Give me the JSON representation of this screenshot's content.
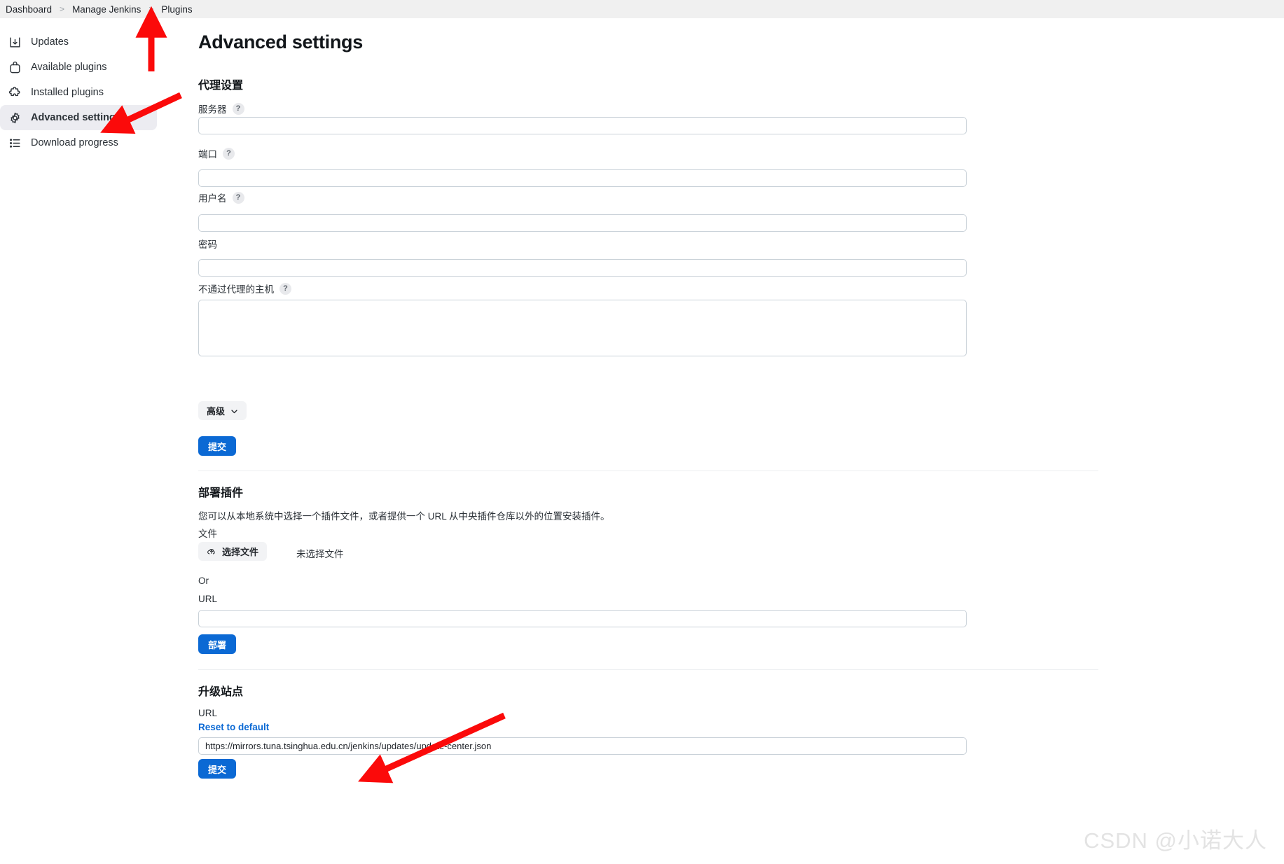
{
  "breadcrumb": {
    "items": [
      "Dashboard",
      "Manage Jenkins",
      "Plugins"
    ],
    "separator": ">"
  },
  "sidebar": {
    "items": [
      {
        "label": "Updates",
        "icon": "download-icon",
        "active": false
      },
      {
        "label": "Available plugins",
        "icon": "plugin-bag-icon",
        "active": false
      },
      {
        "label": "Installed plugins",
        "icon": "puzzle-icon",
        "active": false
      },
      {
        "label": "Advanced settings",
        "icon": "gear-icon",
        "active": true
      },
      {
        "label": "Download progress",
        "icon": "list-icon",
        "active": false
      }
    ]
  },
  "page": {
    "title": "Advanced settings"
  },
  "proxy_section": {
    "heading": "代理设置",
    "fields": [
      {
        "label": "服务器",
        "help": "?",
        "value": "",
        "has_help": true
      },
      {
        "label": "端口",
        "help": "?",
        "value": "",
        "has_help": true
      },
      {
        "label": "用户名",
        "help": "?",
        "value": "",
        "has_help": true
      },
      {
        "label": "密码",
        "help": "",
        "value": "",
        "has_help": false
      },
      {
        "label": "不通过代理的主机",
        "help": "?",
        "value": "",
        "has_help": true
      }
    ],
    "advanced_button": "高级",
    "submit_button": "提交"
  },
  "deploy_section": {
    "heading": "部署插件",
    "description": "您可以从本地系统中选择一个插件文件，或者提供一个 URL 从中央插件仓库以外的位置安装插件。",
    "file_label": "文件",
    "choose_file_button": "选择文件",
    "no_file_text": "未选择文件",
    "or_text": "Or",
    "url_label": "URL",
    "url_value": "",
    "deploy_button": "部署"
  },
  "update_site_section": {
    "heading": "升级站点",
    "url_label": "URL",
    "reset_link": "Reset to default",
    "url_value": "https://mirrors.tuna.tsinghua.edu.cn/jenkins/updates/update-center.json",
    "submit_button": "提交"
  },
  "watermark": "CSDN @小诺大人",
  "colors": {
    "accent": "#0b69d4",
    "annotation_arrow": "#fb0a0a",
    "breadcrumb_bg": "#f0f0f0",
    "sidebar_active_bg": "#ececf1"
  },
  "annotations": [
    {
      "name": "arrow-to-plugins-breadcrumb",
      "points_at": "Plugins"
    },
    {
      "name": "arrow-to-advanced-settings",
      "points_at": "Advanced settings"
    },
    {
      "name": "arrow-to-update-site-url",
      "points_at": "update site URL field"
    }
  ]
}
